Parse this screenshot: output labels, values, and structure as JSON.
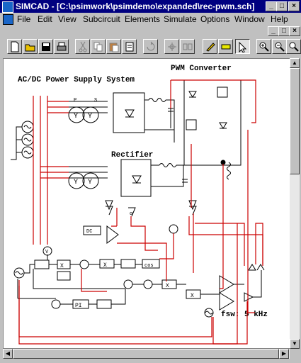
{
  "window": {
    "title": "SIMCAD - [C:\\psimwork\\psimdemo\\expanded\\rec-pwm.sch]",
    "minimize": "_",
    "maximize": "□",
    "close": "×"
  },
  "menubar": {
    "items": [
      {
        "label": "File"
      },
      {
        "label": "Edit"
      },
      {
        "label": "View"
      },
      {
        "label": "Subcircuit"
      },
      {
        "label": "Elements"
      },
      {
        "label": "Simulate"
      },
      {
        "label": "Options"
      },
      {
        "label": "Window"
      },
      {
        "label": "Help"
      }
    ]
  },
  "toolbar": {
    "buttons": [
      {
        "icon": "new-file-icon"
      },
      {
        "icon": "open-folder-icon"
      },
      {
        "icon": "save-icon"
      },
      {
        "icon": "print-icon"
      },
      {
        "icon": "cut-icon"
      },
      {
        "icon": "copy-icon"
      },
      {
        "icon": "paste-icon"
      },
      {
        "icon": "clipboard-icon"
      },
      {
        "icon": "rotate-icon"
      },
      {
        "icon": "flip-icon"
      },
      {
        "icon": "mirror-icon"
      },
      {
        "icon": "wire-pencil-icon"
      },
      {
        "icon": "label-icon"
      },
      {
        "icon": "select-arrow-icon"
      },
      {
        "icon": "zoom-in-icon"
      },
      {
        "icon": "zoom-out-icon"
      },
      {
        "icon": "zoom-fit-icon"
      }
    ]
  },
  "schematic": {
    "label_ac_dc": "AC/DC Power Supply System",
    "label_pwm": "PWM Converter",
    "label_rectifier": "Rectifier",
    "label_fsw": "fsw: 5 kHz",
    "block_x": "X",
    "block_pi": "PI",
    "block_cos": "cos",
    "block_dc": "DC",
    "block_alpha": "α",
    "block_v": "V",
    "transformer_p": "P",
    "transformer_s": "S"
  }
}
